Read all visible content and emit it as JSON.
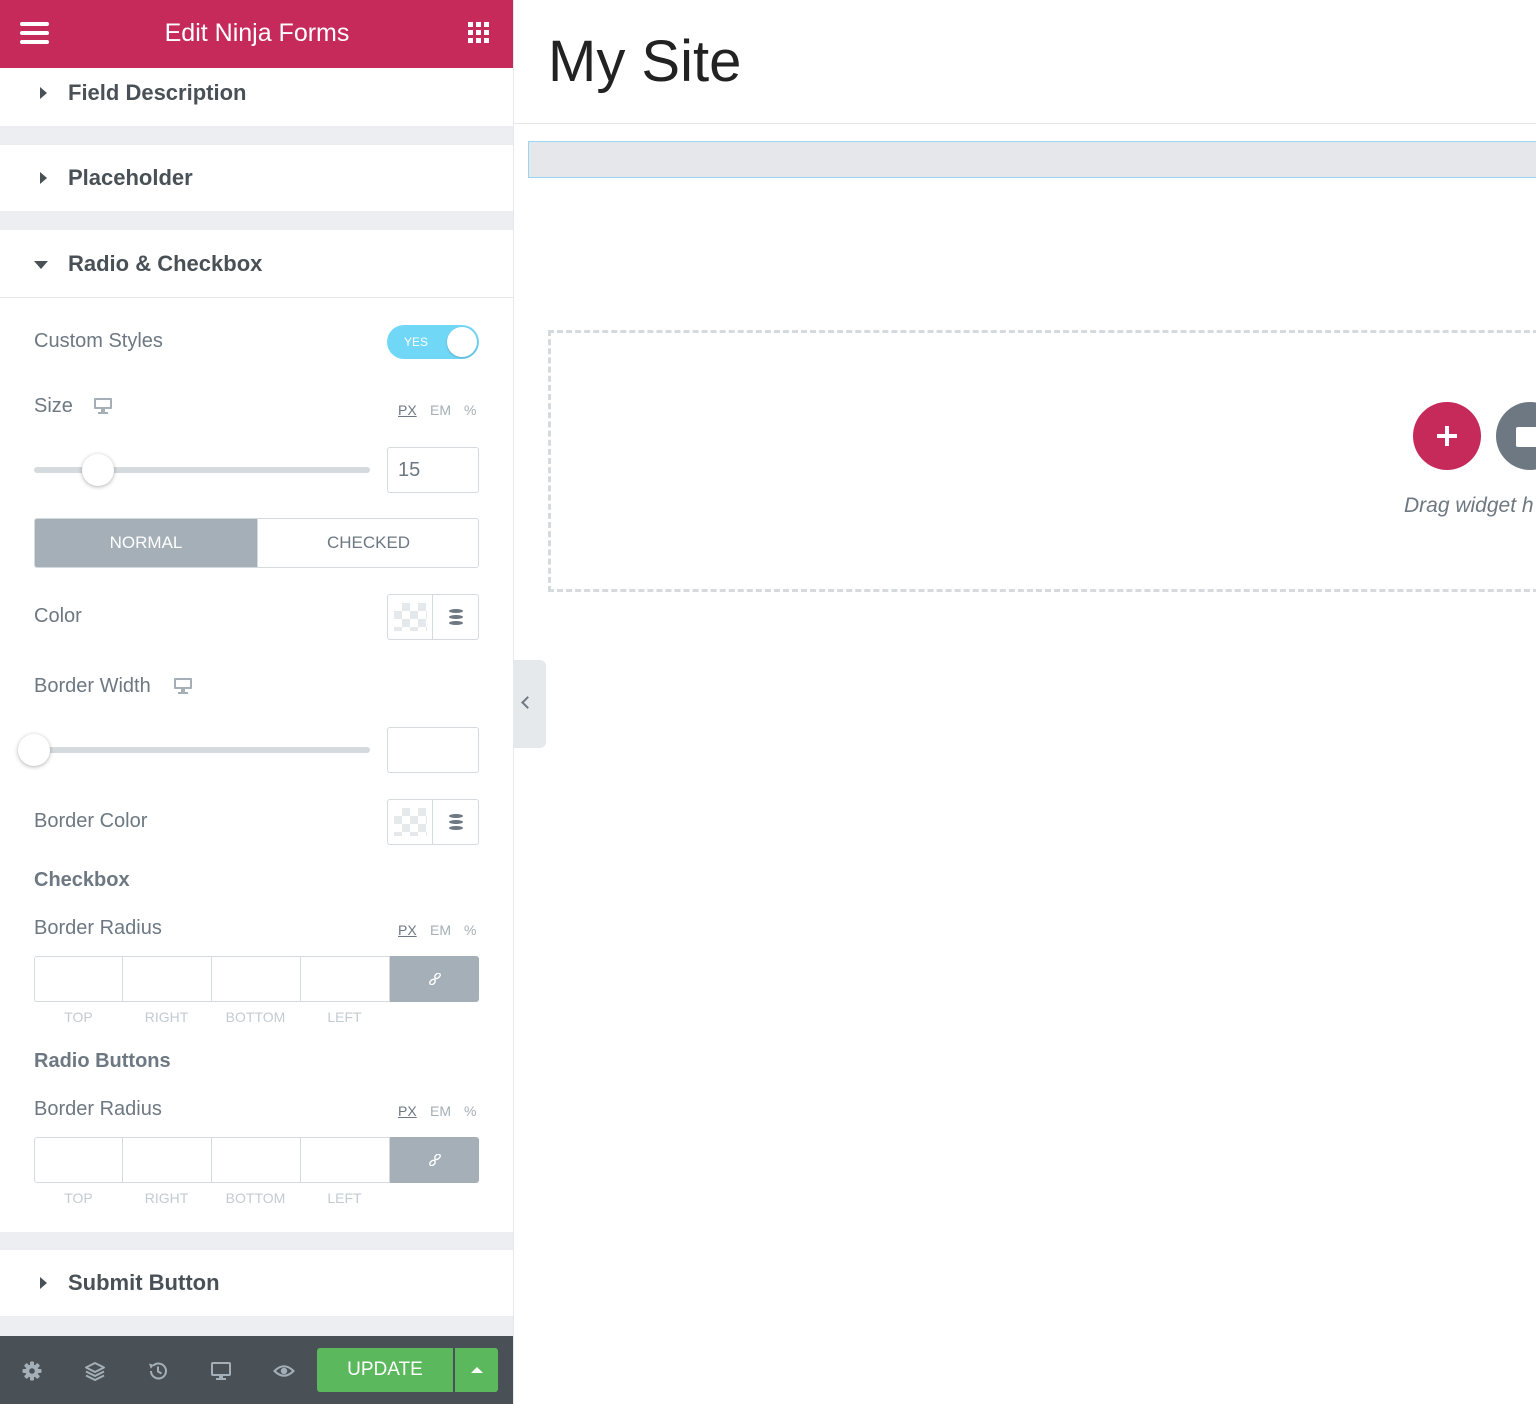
{
  "header": {
    "title": "Edit Ninja Forms"
  },
  "sections": {
    "field_description": "Field Description",
    "placeholder": "Placeholder",
    "radio_checkbox": "Radio & Checkbox",
    "submit_button": "Submit Button"
  },
  "controls": {
    "custom_styles": {
      "label": "Custom Styles",
      "toggle_text": "YES",
      "value": true
    },
    "size": {
      "label": "Size",
      "value": "15",
      "units": [
        "PX",
        "EM",
        "%"
      ],
      "active_unit": "PX",
      "slider_fraction": 0.19
    },
    "tabs": {
      "normal": "NORMAL",
      "checked": "CHECKED",
      "active": "NORMAL"
    },
    "color": {
      "label": "Color"
    },
    "border_width": {
      "label": "Border Width",
      "value": "",
      "slider_fraction": 0
    },
    "border_color": {
      "label": "Border Color"
    },
    "checkbox": {
      "heading": "Checkbox",
      "border_radius_label": "Border Radius",
      "units": [
        "PX",
        "EM",
        "%"
      ],
      "dims": [
        "TOP",
        "RIGHT",
        "BOTTOM",
        "LEFT"
      ]
    },
    "radio_buttons": {
      "heading": "Radio Buttons",
      "border_radius_label": "Border Radius",
      "units": [
        "PX",
        "EM",
        "%"
      ],
      "dims": [
        "TOP",
        "RIGHT",
        "BOTTOM",
        "LEFT"
      ]
    }
  },
  "footer": {
    "update_label": "UPDATE"
  },
  "canvas": {
    "site_title": "My Site",
    "drag_text": "Drag widget h"
  },
  "colors": {
    "brand": "#c52a5b",
    "toggle_on": "#71d7f7",
    "update_green": "#5cb85c",
    "footer_bg": "#495157"
  },
  "icons": {
    "menu": "hamburger-icon",
    "apps": "grid-icon",
    "responsive": "monitor-icon",
    "global": "database-icon",
    "link": "link-icon",
    "footer": [
      "gear-icon",
      "layers-icon",
      "history-icon",
      "monitor-icon",
      "eye-icon"
    ]
  }
}
